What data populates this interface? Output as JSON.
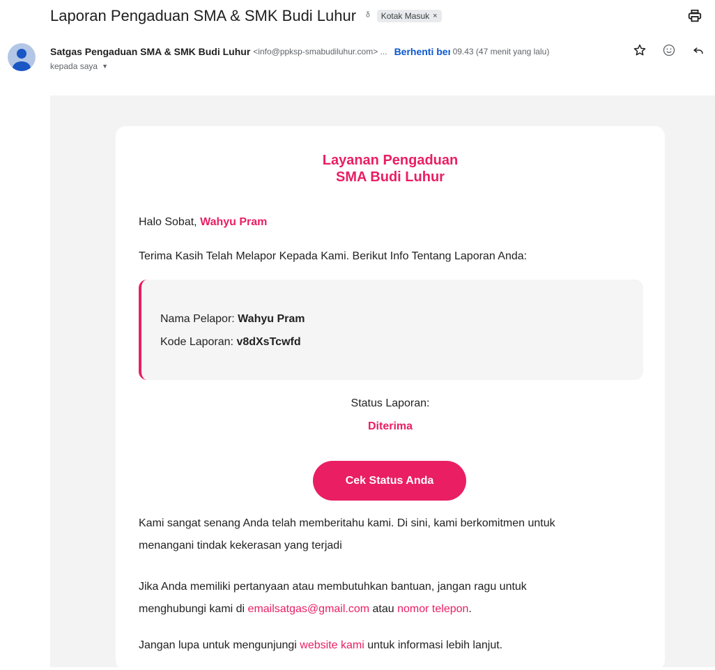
{
  "email": {
    "subject": "Laporan Pengaduan SMA & SMK Budi Luhur",
    "label": "Kotak Masuk",
    "label_remove": "×",
    "sender_name": "Satgas Pengaduan SMA & SMK Budi Luhur",
    "sender_email": "<info@ppksp-smabudiluhur.com> ...",
    "unsubscribe": "Berhenti berlangganan",
    "time": "09.43 (47 menit yang lalu)",
    "to": "kepada saya"
  },
  "body": {
    "title_line1": "Layanan Pengaduan",
    "title_line2": "SMA Budi Luhur",
    "greeting_prefix": "Halo Sobat,",
    "greeting_name": "Wahyu Pram",
    "intro": "Terima Kasih Telah Melapor Kepada Kami. Berikut Info Tentang Laporan Anda:",
    "reporter_label": "Nama Pelapor:",
    "reporter_value": "Wahyu Pram",
    "code_label": "Kode Laporan:",
    "code_value": "v8dXsTcwfd",
    "status_label": "Status Laporan:",
    "status_value": "Diterima",
    "cta_label": "Cek Status Anda",
    "para1_line1": "Kami sangat senang Anda telah memberitahu kami. Di sini, kami berkomitmen untuk",
    "para1_line2": "menangani tindak kekerasan yang terjadi",
    "para2_line1": "Jika Anda memiliki pertanyaan atau membutuhkan bantuan, jangan ragu untuk",
    "para2_prefix": "menghubungi kami di",
    "para2_email": "emailsatgas@gmail.com",
    "para2_mid": "atau",
    "para2_phone": "nomor telepon",
    "para2_end": ".",
    "para3_prefix": "Jangan lupa untuk mengunjungi",
    "para3_link": "website kami",
    "para3_suffix": "untuk informasi lebih lanjut."
  },
  "colors": {
    "accent": "#e91e63",
    "link_blue": "#0b57d0",
    "avatar": "#b4c6e6"
  },
  "icons": [
    "important-icon",
    "print-icon",
    "star-icon",
    "emoji-icon",
    "reply-icon",
    "caret-down-icon"
  ]
}
